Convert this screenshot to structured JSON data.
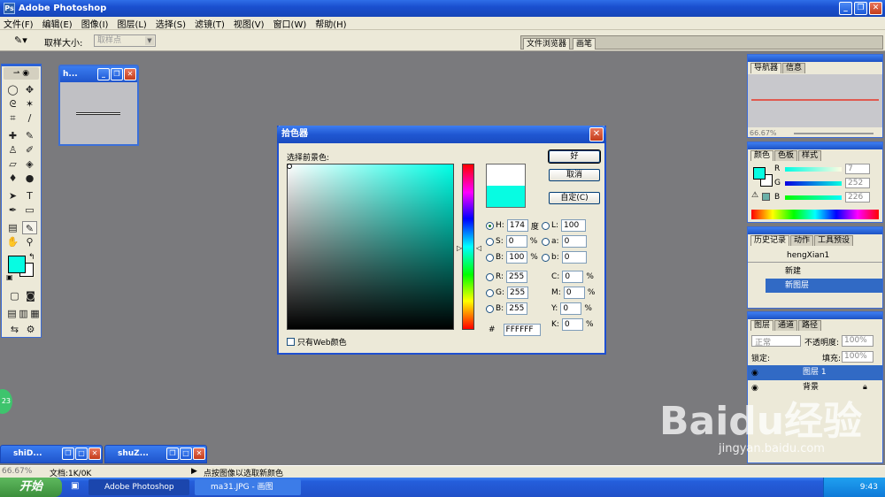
{
  "app": {
    "title": "Adobe Photoshop"
  },
  "menu": [
    "文件(F)",
    "编辑(E)",
    "图像(I)",
    "图层(L)",
    "选择(S)",
    "滤镜(T)",
    "视图(V)",
    "窗口(W)",
    "帮助(H)"
  ],
  "options": {
    "sample_label": "取样大小:",
    "sample_value": "取样点"
  },
  "palette_well": {
    "tabs": [
      "文件浏览器",
      "画笔"
    ]
  },
  "doc_window": {
    "title": "h..."
  },
  "picker": {
    "title": "拾色器",
    "prompt": "选择前景色:",
    "buttons": {
      "ok": "好",
      "cancel": "取消",
      "custom": "自定(C)"
    },
    "hsb": {
      "h": "174",
      "h_unit": "度",
      "s": "0",
      "s_unit": "%",
      "b": "100",
      "b_unit": "%"
    },
    "lab": {
      "l": "100",
      "a": "0",
      "b": "0"
    },
    "rgb": {
      "r": "255",
      "g": "255",
      "b": "255"
    },
    "cmyk": {
      "c": "0",
      "m": "0",
      "y": "0",
      "k": "0",
      "unit": "%"
    },
    "hex": "FFFFFF",
    "labels": {
      "H": "H:",
      "S": "S:",
      "B": "B:",
      "L": "L:",
      "a": "a:",
      "b": "b:",
      "R": "R:",
      "G": "G:",
      "Bb": "B:",
      "C": "C:",
      "M": "M:",
      "Y": "Y:",
      "K": "K:",
      "hash": "#"
    },
    "web_only": "只有Web颜色",
    "new_color": "#ffffff",
    "old_color": "#07fce2"
  },
  "navigator": {
    "tabs": [
      "导航器",
      "信息"
    ],
    "zoom": "66.67%"
  },
  "color_panel": {
    "tabs": [
      "颜色",
      "色板",
      "样式"
    ],
    "r": "7",
    "g": "252",
    "b": "226",
    "r_label": "R",
    "g_label": "G",
    "b_label": "B"
  },
  "history": {
    "tabs": [
      "历史记录",
      "动作",
      "工具预设"
    ],
    "snapshot": "hengXian1",
    "items": [
      "新建",
      "新图层"
    ]
  },
  "layers": {
    "tabs": [
      "图层",
      "通道",
      "路径"
    ],
    "mode": "正常",
    "opacity_label": "不透明度:",
    "opacity": "100%",
    "lock_label": "锁定:",
    "fill_label": "填充:",
    "fill": "100%",
    "items": [
      "图层 1",
      "背景"
    ]
  },
  "minimized": [
    "shiD...",
    "shuZ..."
  ],
  "status": {
    "zoom": "66.67%",
    "doc": "文档:1K/0K",
    "hint": "点按图像以选取新颜色"
  },
  "taskbar": {
    "start": "开始",
    "tasks": [
      "Adobe Photoshop",
      "ma31.JPG - 画图"
    ],
    "clock": "9:43"
  },
  "badge": "23",
  "watermark": {
    "logo": "Baidu经验",
    "url": "jingyan.baidu.com"
  },
  "colors": {
    "foreground": "#07fce2",
    "accent": "#1f57d2"
  }
}
